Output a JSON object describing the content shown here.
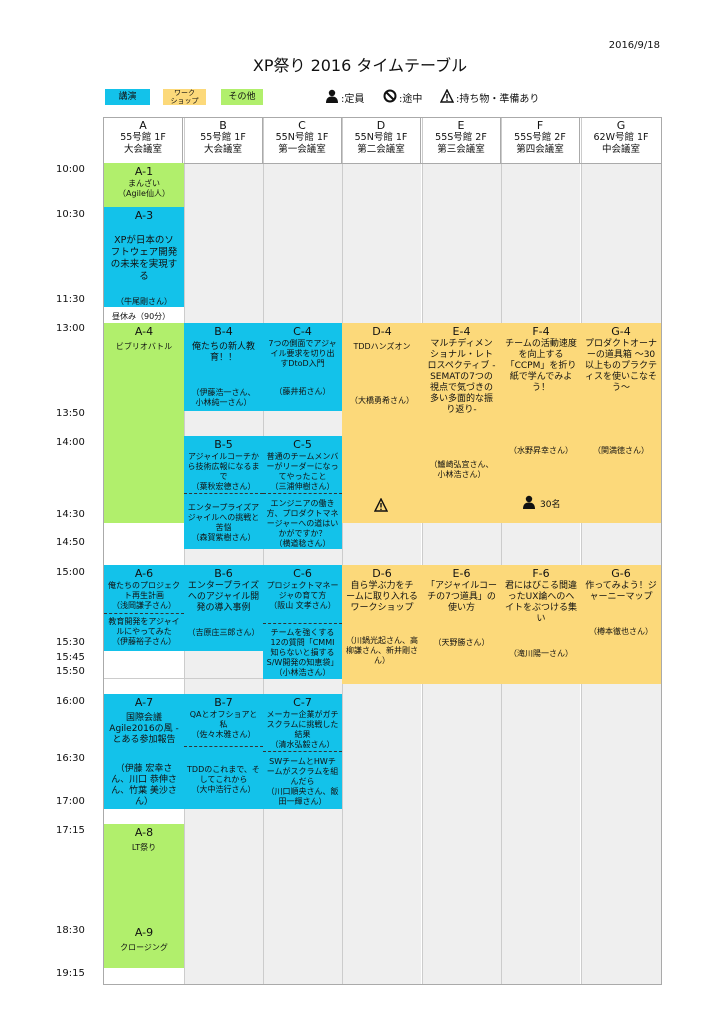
{
  "date": "2016/9/18",
  "title": "XP祭り 2016 タイムテーブル",
  "legend": {
    "lecture": "講演",
    "workshop_line1": "ワーク",
    "workshop_line2": "ショップ",
    "other": "その他",
    "capacity": ":定員",
    "midway": ":途中",
    "bring": ":持ち物・準備あり"
  },
  "colors": {
    "other": "#b1ef6c",
    "lecture": "#13c2ea",
    "workshop": "#fcd97a",
    "empty": "#efefef"
  },
  "columns": [
    {
      "letter": "A",
      "building": "55号館 1F",
      "room": "大会議室"
    },
    {
      "letter": "B",
      "building": "55号館 1F",
      "room": "大会議室"
    },
    {
      "letter": "C",
      "building": "55N号館 1F",
      "room": "第一会議室"
    },
    {
      "letter": "D",
      "building": "55N号館 1F",
      "room": "第二会議室"
    },
    {
      "letter": "E",
      "building": "55S号館 2F",
      "room": "第三会議室"
    },
    {
      "letter": "F",
      "building": "55S号館 2F",
      "room": "第四会議室"
    },
    {
      "letter": "G",
      "building": "62W号館 1F",
      "room": "中会議室"
    }
  ],
  "times": [
    "10:00",
    "10:30",
    "11:30",
    "13:00",
    "13:50",
    "14:00",
    "14:30",
    "14:50",
    "15:00",
    "15:30",
    "15:45",
    "15:50",
    "16:00",
    "16:30",
    "17:00",
    "17:15",
    "18:30",
    "19:15"
  ],
  "lunch": "昼休み（90分）",
  "sessions": {
    "A1": {
      "code": "A-1",
      "title": "まんざい",
      "speaker": "（Agile仙人）"
    },
    "A3": {
      "code": "A-3",
      "title": "XPが日本のソフトウェア開発の未来を実現する",
      "speaker": "（牛尾剛さん）"
    },
    "A4": {
      "code": "A-4",
      "title": "ビブリオバトル"
    },
    "A6": {
      "code": "A-6",
      "title": "俺たちのプロジェクト再生計画",
      "speaker": "（浅岡謙子さん）"
    },
    "A6b": {
      "title": "教育開発をアジャイルにやってみた",
      "speaker": "（伊藤裕子さん）"
    },
    "A7": {
      "code": "A-7",
      "title": "国際会議Agile2016の風 - とある参加報告",
      "speaker": "（伊藤 宏幸さん、川口 恭伸さん、竹葉 美沙さん）"
    },
    "A8": {
      "code": "A-8",
      "title": "LT祭り"
    },
    "A9": {
      "code": "A-9",
      "title": "クロージング"
    },
    "B4": {
      "code": "B-4",
      "title": "俺たちの新人教育！！",
      "speaker": "（伊藤浩一さん、小林純一さん）"
    },
    "B5": {
      "code": "B-5",
      "title": "アジャイルコーチから技術広報になるまで",
      "speaker": "（葉秋宏德さん）"
    },
    "B5b": {
      "title": "エンタープライズアジャイルへの挑戦と苦悩",
      "speaker": "（森賀紫樹さん）"
    },
    "B6": {
      "code": "B-6",
      "title": "エンタープライズへのアジャイル開発の導入事例",
      "speaker": "（吉原庄三郎さん）"
    },
    "B7": {
      "code": "B-7",
      "title": "QAとオフショアと私",
      "speaker": "（佐々木雅さん）"
    },
    "B7b": {
      "title": "TDDのこれまで、そしてこれから",
      "speaker": "（大中浩行さん）"
    },
    "C4": {
      "code": "C-4",
      "title": "7つの側面でアジャイル要求を切り出すDtoD入門",
      "speaker": "（藤井拓さん）"
    },
    "C5": {
      "code": "C-5",
      "title": "普通のチームメンバーがリーダーになってやったこと",
      "speaker": "（三浦伸樹さん）"
    },
    "C5b": {
      "title": "エンジニアの働き方、プロダクトマネージャーへの道はいかがですか？",
      "speaker": "（横道稔さん）"
    },
    "C6": {
      "code": "C-6",
      "title": "プロジェクトマネージャの育て方",
      "speaker": "（阪山 文孝さん）"
    },
    "C6b": {
      "title": "チームを強くする12の質問「CMMI 知らないと損するS/W開発の知恵袋」",
      "speaker": "（小林浩さん）"
    },
    "C7": {
      "code": "C-7",
      "title": "メーカー企業がガチスクラムに挑戦した結果",
      "speaker": "（清水弘毅さん）"
    },
    "C7b": {
      "title": "SWチームとHWチームがスクラムを組んだら",
      "speaker": "（川口順央さん、飯田一輝さん）"
    },
    "D4": {
      "code": "D-4",
      "title": "TDDハンズオン",
      "speaker": "（大橋勇希さん）"
    },
    "D6": {
      "code": "D-6",
      "title": "自ら学ぶ力をチームに取り入れるワークショップ",
      "speaker": "（川鍋光起さん、高柳謙さん、新井剛さん）"
    },
    "E4": {
      "code": "E-4",
      "title": "マルチディメンショナル・レトロスペクティブ -SEMATの7つの視点で気づきの多い多面的な振り返り-",
      "speaker": "（鱸崎弘宜さん、小林浩さん）"
    },
    "E6": {
      "code": "E-6",
      "title": "「アジャイルコーチの7つ道具」の使い方",
      "speaker": "（天野勝さん）"
    },
    "F4": {
      "code": "F-4",
      "title": "チームの活動速度を向上する「CCPM」を折り紙で学んでみよう！",
      "speaker": "（水野昇幸さん）",
      "capacity": "30名"
    },
    "F6": {
      "code": "F-6",
      "title": "君にはびこる間違ったUX論へのヘイトをぶつける集い",
      "speaker": "（滝川陽一さん）"
    },
    "G4": {
      "code": "G-4",
      "title": "プロダクトオーナーの道具箱 〜30以上ものプラクティスを使いこなそう〜",
      "speaker": "（関満徳さん）"
    },
    "G6": {
      "code": "G-6",
      "title": "作ってみよう！ジャーニーマップ",
      "speaker": "（樽本徹也さん）"
    }
  }
}
